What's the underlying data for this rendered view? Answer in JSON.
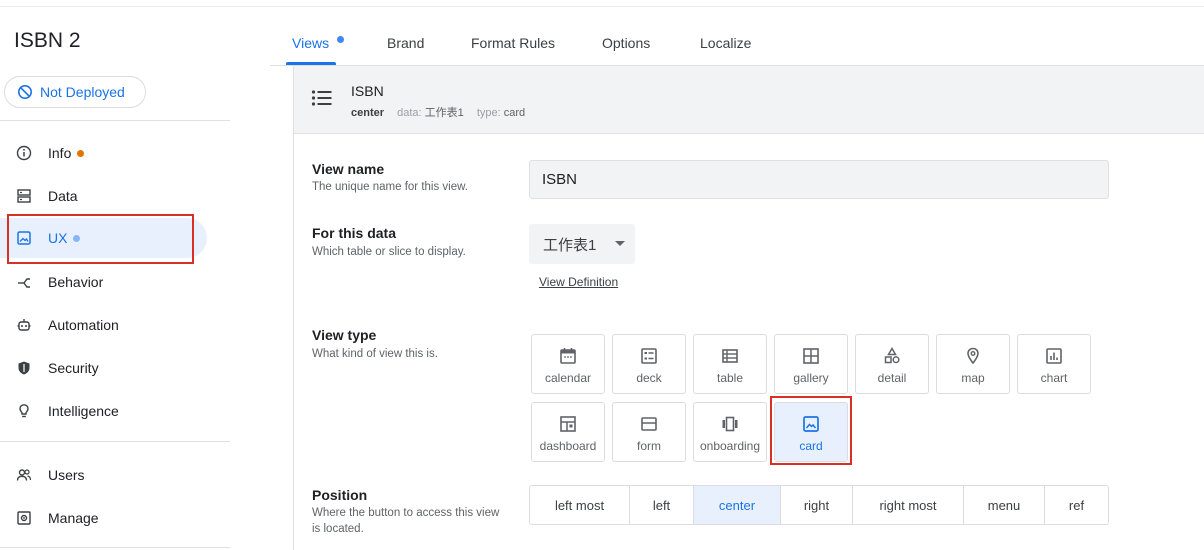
{
  "app": {
    "title": "ISBN 2",
    "deploy_status": "Not Deployed"
  },
  "sidebar": {
    "items": [
      {
        "label": "Info",
        "icon": "info-icon"
      },
      {
        "label": "Data",
        "icon": "data-icon"
      },
      {
        "label": "UX",
        "icon": "ux-icon"
      },
      {
        "label": "Behavior",
        "icon": "behavior-icon"
      },
      {
        "label": "Automation",
        "icon": "automation-icon"
      },
      {
        "label": "Security",
        "icon": "shield-icon"
      },
      {
        "label": "Intelligence",
        "icon": "lightbulb-icon"
      },
      {
        "label": "Users",
        "icon": "users-icon"
      },
      {
        "label": "Manage",
        "icon": "manage-icon"
      }
    ]
  },
  "tabs": [
    {
      "label": "Views"
    },
    {
      "label": "Brand"
    },
    {
      "label": "Format Rules"
    },
    {
      "label": "Options"
    },
    {
      "label": "Localize"
    }
  ],
  "view": {
    "name": "ISBN",
    "position": "center",
    "data_key": "data:",
    "data_value": "工作表1",
    "type_key": "type:",
    "type_value": "card"
  },
  "form": {
    "view_name_label": "View name",
    "view_name_desc": "The unique name for this view.",
    "view_name_value": "ISBN",
    "for_data_label": "For this data",
    "for_data_desc": "Which table or slice to display.",
    "for_data_value": "工作表1",
    "view_definition_link": "View Definition",
    "view_type_label": "View type",
    "view_type_desc": "What kind of view this is.",
    "view_types": [
      "calendar",
      "deck",
      "table",
      "gallery",
      "detail",
      "map",
      "chart",
      "dashboard",
      "form",
      "onboarding",
      "card"
    ],
    "selected_view_type": "card",
    "position_label": "Position",
    "position_desc": "Where the button to access this view is located.",
    "positions": [
      "left most",
      "left",
      "center",
      "right",
      "right most",
      "menu",
      "ref"
    ],
    "selected_position": "center"
  },
  "colors": {
    "accent": "#1a73e8",
    "highlight_border": "#d93025",
    "info_dot": "#e37400"
  }
}
